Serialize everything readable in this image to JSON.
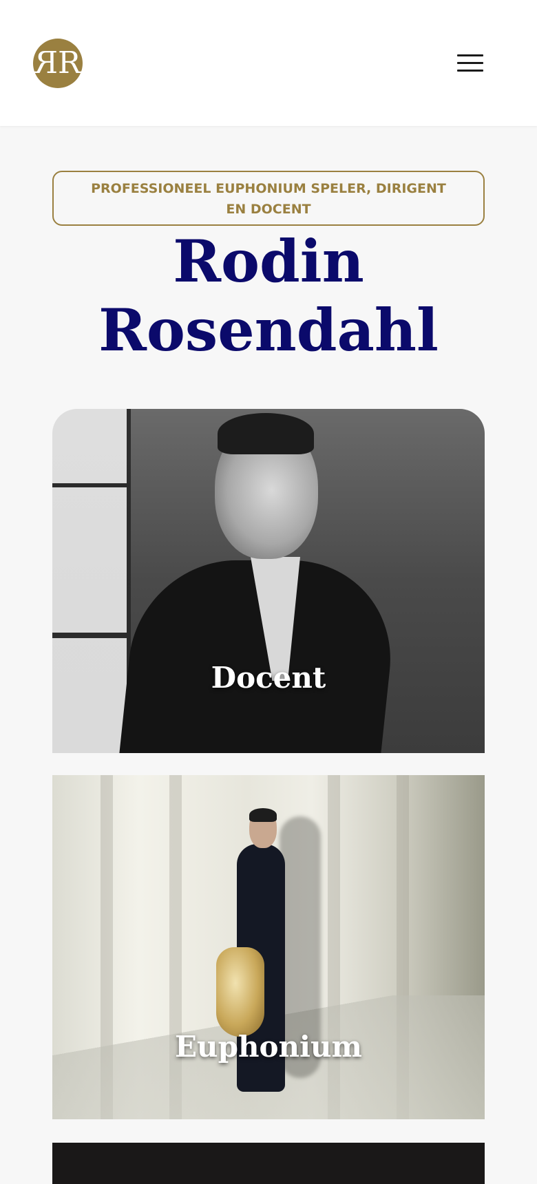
{
  "header": {
    "logo_text": "R",
    "menu_icon": "hamburger-menu-icon"
  },
  "hero": {
    "tagline": "PROFESSIONEEL EUPHONIUM SPELER, DIRIGENT EN DOCENT",
    "title_line1": "Rodin",
    "title_line2": "Rosendahl"
  },
  "cards": [
    {
      "label": "Docent"
    },
    {
      "label": "Euphonium"
    }
  ],
  "colors": {
    "accent": "#9a8040",
    "title": "#0b0a6b",
    "background": "#f7f7f7"
  }
}
